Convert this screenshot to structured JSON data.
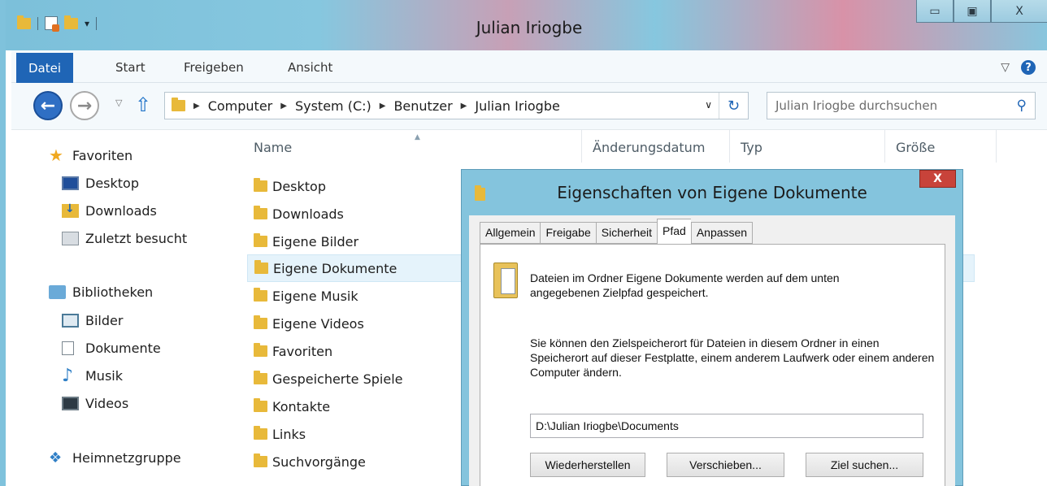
{
  "window": {
    "title": "Julian Iriogbe",
    "controls": {
      "minimize": "▭",
      "maximize": "▣",
      "close": "X"
    }
  },
  "ribbon": {
    "tabs": [
      "Datei",
      "Start",
      "Freigeben",
      "Ansicht"
    ],
    "expand_icon": "chevron-down-icon",
    "help_label": "?"
  },
  "addressbar": {
    "crumbs": [
      "Computer",
      "System (C:)",
      "Benutzer",
      "Julian Iriogbe"
    ],
    "search_placeholder": "Julian Iriogbe durchsuchen"
  },
  "navigation": {
    "favorites": {
      "label": "Favoriten",
      "items": [
        "Desktop",
        "Downloads",
        "Zuletzt besucht"
      ]
    },
    "libraries": {
      "label": "Bibliotheken",
      "items": [
        "Bilder",
        "Dokumente",
        "Musik",
        "Videos"
      ]
    },
    "homegroup": "Heimnetzgruppe"
  },
  "filelist": {
    "columns": [
      "Name",
      "Änderungsdatum",
      "Typ",
      "Größe"
    ],
    "items": [
      "Desktop",
      "Downloads",
      "Eigene Bilder",
      "Eigene Dokumente",
      "Eigene Musik",
      "Eigene Videos",
      "Favoriten",
      "Gespeicherte Spiele",
      "Kontakte",
      "Links",
      "Suchvorgänge"
    ],
    "selected": "Eigene Dokumente"
  },
  "dialog": {
    "title": "Eigenschaften von Eigene Dokumente",
    "close_label": "X",
    "tabs": [
      "Allgemein",
      "Freigabe",
      "Sicherheit",
      "Pfad",
      "Anpassen"
    ],
    "active_tab": "Pfad",
    "text1": "Dateien im Ordner Eigene Dokumente werden auf dem unten angegebenen Zielpfad gespeichert.",
    "text2": "Sie können den Zielspeicherort für Dateien in diesem Ordner in einen Speicherort auf dieser Festplatte, einem anderem Laufwerk oder einem anderen Computer ändern.",
    "path_value": "D:\\Julian Iriogbe\\Documents",
    "buttons": [
      "Wiederherstellen",
      "Verschieben...",
      "Ziel suchen..."
    ]
  },
  "colors": {
    "accent": "#1f65b6",
    "titlebar": "#86c7df",
    "selection": "#e5f3fb",
    "close": "#c8433a"
  }
}
